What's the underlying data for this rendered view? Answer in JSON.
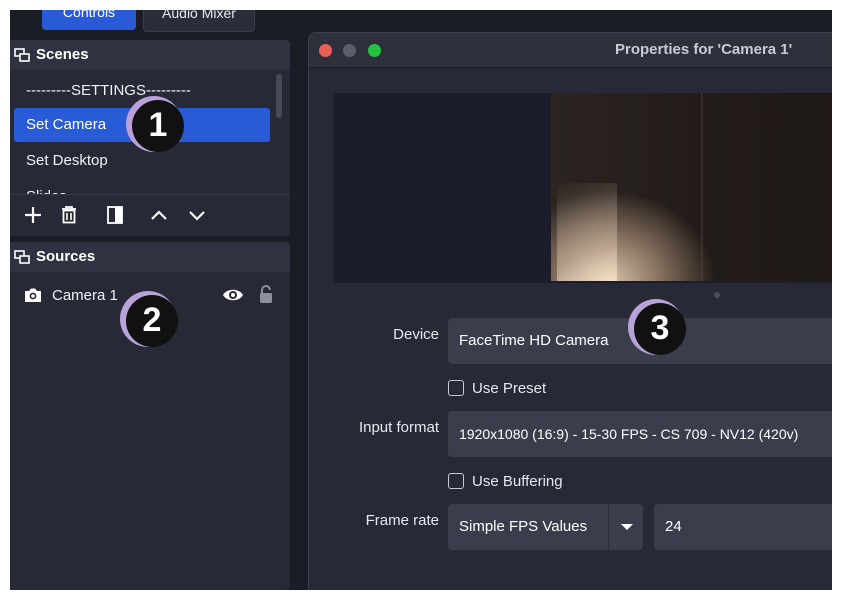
{
  "top_tabs": {
    "controls": "Controls",
    "audio_mixer": "Audio Mixer"
  },
  "scenes": {
    "title": "Scenes",
    "items": [
      {
        "label": "---------SETTINGS---------"
      },
      {
        "label": "Set Camera",
        "selected": true
      },
      {
        "label": "Set Desktop"
      },
      {
        "label": "Slides"
      }
    ],
    "toolbar": [
      "add-icon",
      "trash-icon",
      "filter-icon",
      "chevron-up-icon",
      "chevron-down-icon"
    ]
  },
  "sources": {
    "title": "Sources",
    "items": [
      {
        "label": "Camera 1",
        "icon": "camera-icon",
        "visible": true,
        "locked": false
      }
    ]
  },
  "properties": {
    "title": "Properties for 'Camera 1'",
    "device": {
      "label": "Device",
      "value": "FaceTime HD Camera"
    },
    "use_preset": {
      "label": "Use Preset",
      "checked": false
    },
    "input_format": {
      "label": "Input format",
      "value": "1920x1080 (16:9) - 15-30 FPS - CS 709 - NV12 (420v)"
    },
    "use_buffering": {
      "label": "Use Buffering",
      "checked": false
    },
    "frame_rate": {
      "label": "Frame rate",
      "mode": "Simple FPS Values",
      "value": "24"
    }
  },
  "badges": [
    "1",
    "2",
    "3"
  ],
  "colors": {
    "accent": "#2a5bd7",
    "badge_halo": "#b9a2d9",
    "panel_bg": "#272a36"
  }
}
